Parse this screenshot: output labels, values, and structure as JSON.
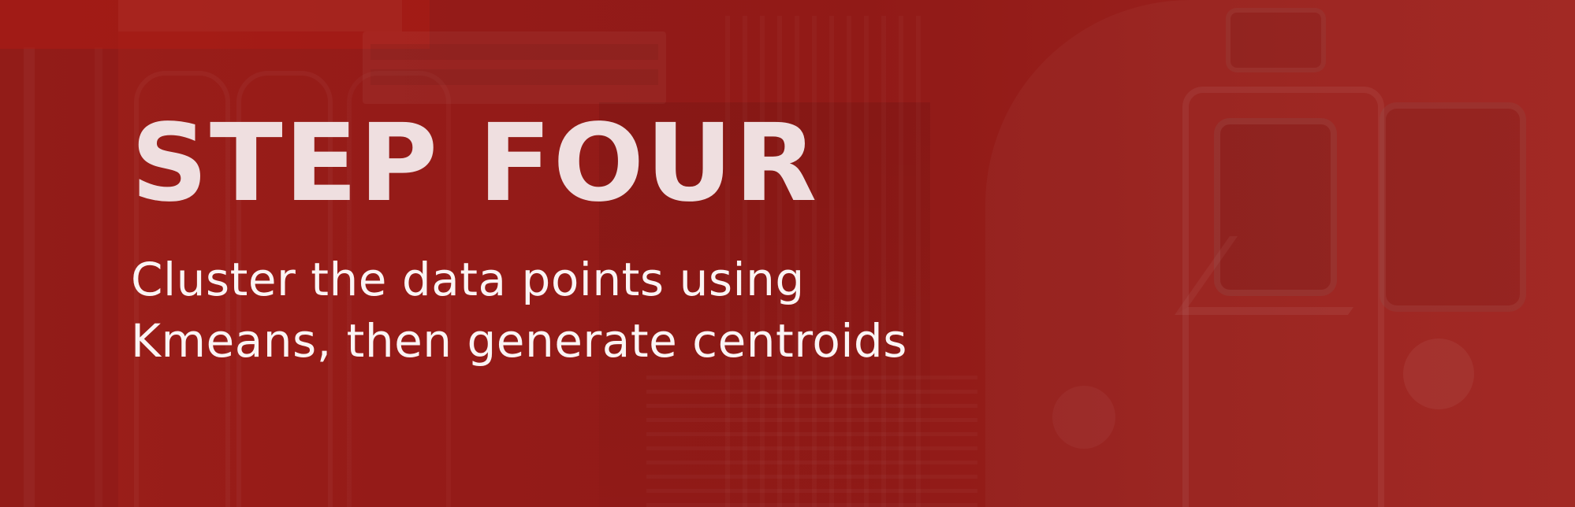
{
  "banner": {
    "title": "STEP FOUR",
    "subtitle_lines": [
      "Cluster the data points using",
      "Kmeans, then generate centroids"
    ]
  },
  "colors": {
    "overlay": "#9a1f1a",
    "title": "#efdfe0",
    "subtitle": "#fbf4f4"
  }
}
